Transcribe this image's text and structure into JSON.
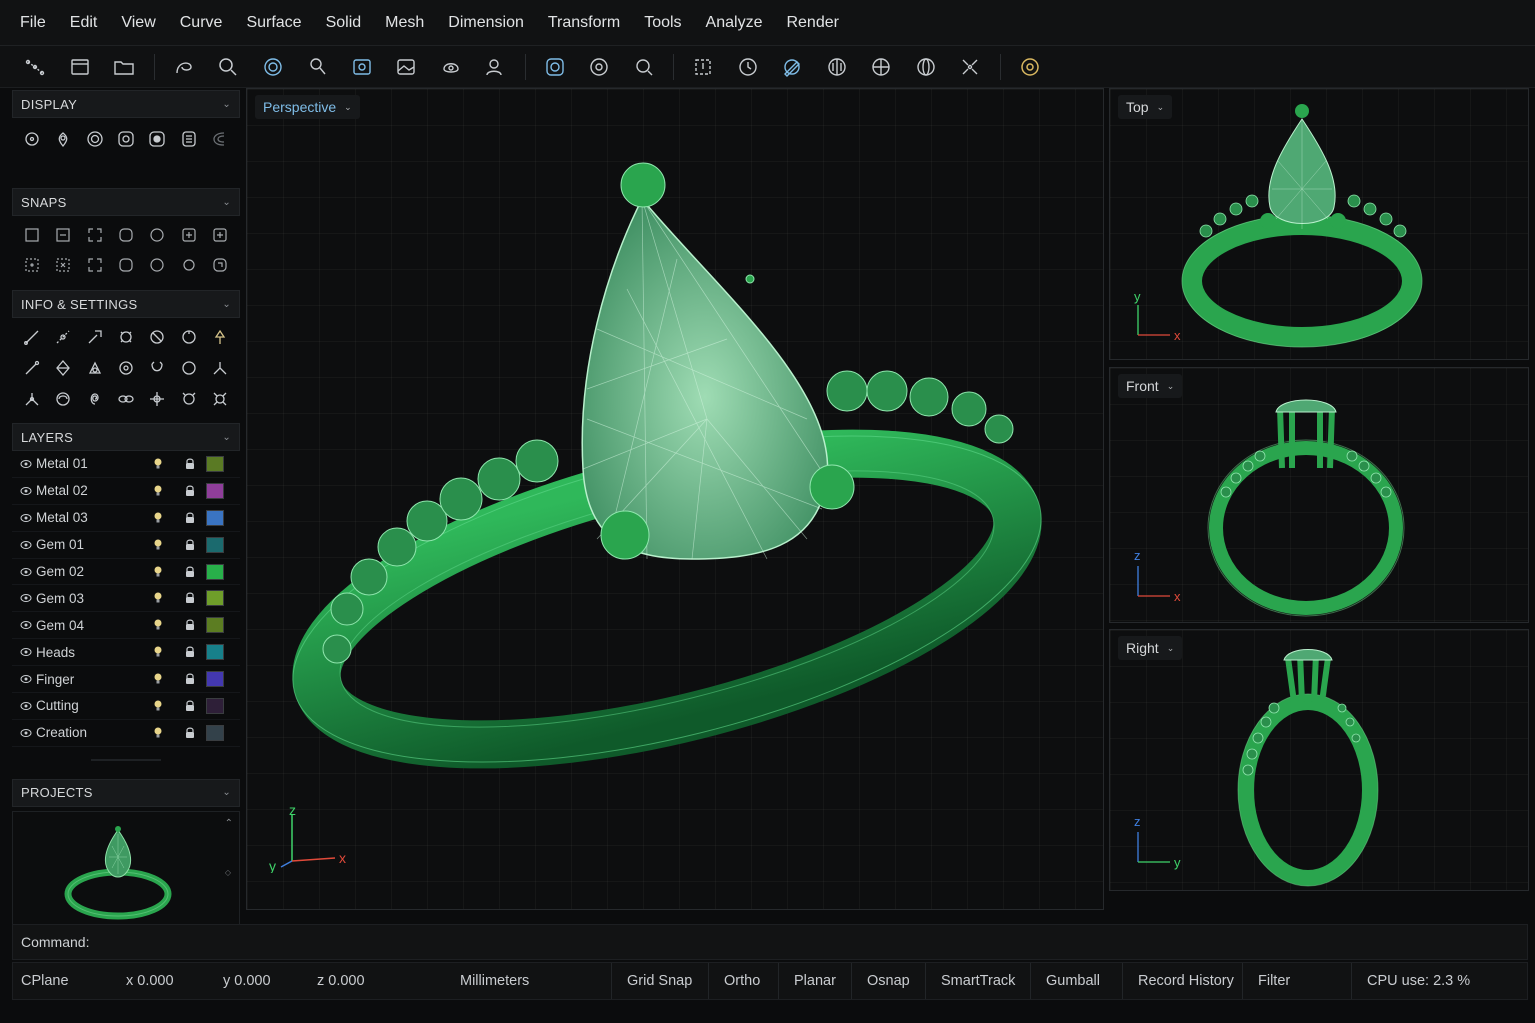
{
  "menu": [
    "File",
    "Edit",
    "View",
    "Curve",
    "Surface",
    "Solid",
    "Mesh",
    "Dimension",
    "Transform",
    "Tools",
    "Analyze",
    "Render"
  ],
  "toolbar_icons": [
    "select-points-icon",
    "new-file-icon",
    "open-folder-icon",
    "curve-tool-icon",
    "zoom-icon",
    "target-icon",
    "lasso-icon",
    "display-icon",
    "image-icon",
    "rotate-view-icon",
    "user-view-icon",
    "shaded-icon",
    "orbit-icon",
    "zoom-extents-icon",
    "frame-icon",
    "clock-icon",
    "pen-icon",
    "gumball-icon",
    "axis-icon",
    "globe-icon",
    "shrink-icon",
    "settings-icon"
  ],
  "panels": {
    "display": {
      "title": "DISPLAY"
    },
    "snaps": {
      "title": "SNAPS"
    },
    "info": {
      "title": "INFO & SETTINGS"
    },
    "layers": {
      "title": "LAYERS"
    },
    "projects": {
      "title": "PROJECTS"
    }
  },
  "layers": [
    {
      "name": "Metal 01",
      "color": "#5a7a24"
    },
    {
      "name": "Metal 02",
      "color": "#8f3e9a"
    },
    {
      "name": "Metal 03",
      "color": "#3a74c2"
    },
    {
      "name": "Gem 01",
      "color": "#1b6a6e"
    },
    {
      "name": "Gem 02",
      "color": "#28b04a"
    },
    {
      "name": "Gem 03",
      "color": "#6f9e2a"
    },
    {
      "name": "Gem 04",
      "color": "#5c7d22"
    },
    {
      "name": "Heads",
      "color": "#17808a"
    },
    {
      "name": "Finger",
      "color": "#4338b0"
    },
    {
      "name": "Cutting",
      "color": "#2e1f38"
    },
    {
      "name": "Creation",
      "color": "#33414a"
    }
  ],
  "viewports": {
    "perspective": {
      "label": "Perspective",
      "axes": [
        "z",
        "y",
        "x"
      ]
    },
    "top": {
      "label": "Top",
      "axes": [
        "y",
        "x"
      ]
    },
    "front": {
      "label": "Front",
      "axes": [
        "z",
        "x"
      ]
    },
    "right": {
      "label": "Right",
      "axes": [
        "z",
        "y"
      ]
    }
  },
  "command": {
    "label": "Command:",
    "value": ""
  },
  "status": {
    "cplane": "CPlane",
    "x": "x 0.000",
    "y": "y 0.000",
    "z": "z 0.000",
    "units": "Millimeters",
    "toggles": [
      "Grid Snap",
      "Ortho",
      "Planar",
      "Osnap",
      "SmartTrack",
      "Gumball",
      "Record History",
      "Filter"
    ],
    "cpu": "CPU use: 2.3 %"
  },
  "colors": {
    "accent": "#7fbde8",
    "model": "#2aa54e",
    "gem": "#6fbf8a"
  }
}
